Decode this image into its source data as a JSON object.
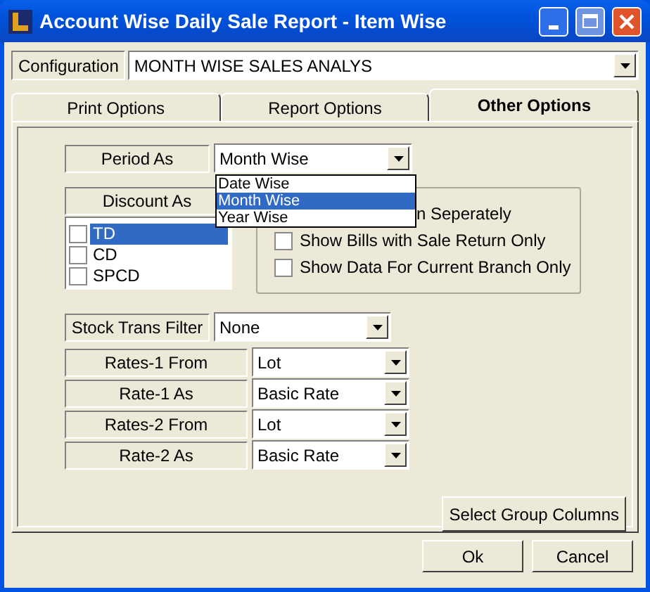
{
  "window": {
    "title": "Account Wise Daily Sale Report - Item Wise"
  },
  "configuration": {
    "label": "Configuration",
    "value": "MONTH WISE SALES ANALYS"
  },
  "tabs": [
    {
      "label": "Print Options",
      "selected": false
    },
    {
      "label": "Report Options",
      "selected": false
    },
    {
      "label": "Other Options",
      "selected": true
    }
  ],
  "period": {
    "label": "Period As",
    "value": "Month Wise",
    "expanded": true,
    "options": [
      {
        "label": "Date Wise",
        "selected": false
      },
      {
        "label": "Month Wise",
        "selected": true
      },
      {
        "label": "Year Wise",
        "selected": false
      }
    ]
  },
  "discount": {
    "label": "Discount As",
    "items": [
      {
        "label": "TD",
        "checked": false,
        "selected": true
      },
      {
        "label": "CD",
        "checked": false,
        "selected": false
      },
      {
        "label": "SPCD",
        "checked": false,
        "selected": false
      }
    ]
  },
  "options": [
    {
      "kind": "covered",
      "label": "n Seperately"
    },
    {
      "kind": "checkbox",
      "label": "Show Bills with Sale Return Only",
      "checked": false
    },
    {
      "kind": "checkbox",
      "label": "Show Data For Current Branch Only",
      "checked": false
    }
  ],
  "stock_trans_filter": {
    "label": "Stock Trans Filter",
    "value": "None"
  },
  "rates": [
    {
      "label": "Rates-1 From",
      "value": "Lot"
    },
    {
      "label": "Rate-1 As",
      "value": "Basic Rate"
    },
    {
      "label": "Rates-2 From",
      "value": "Lot"
    },
    {
      "label": "Rate-2 As",
      "value": "Basic Rate"
    }
  ],
  "group_button": "Select Group Columns",
  "buttons": [
    "Ok",
    "Cancel"
  ]
}
